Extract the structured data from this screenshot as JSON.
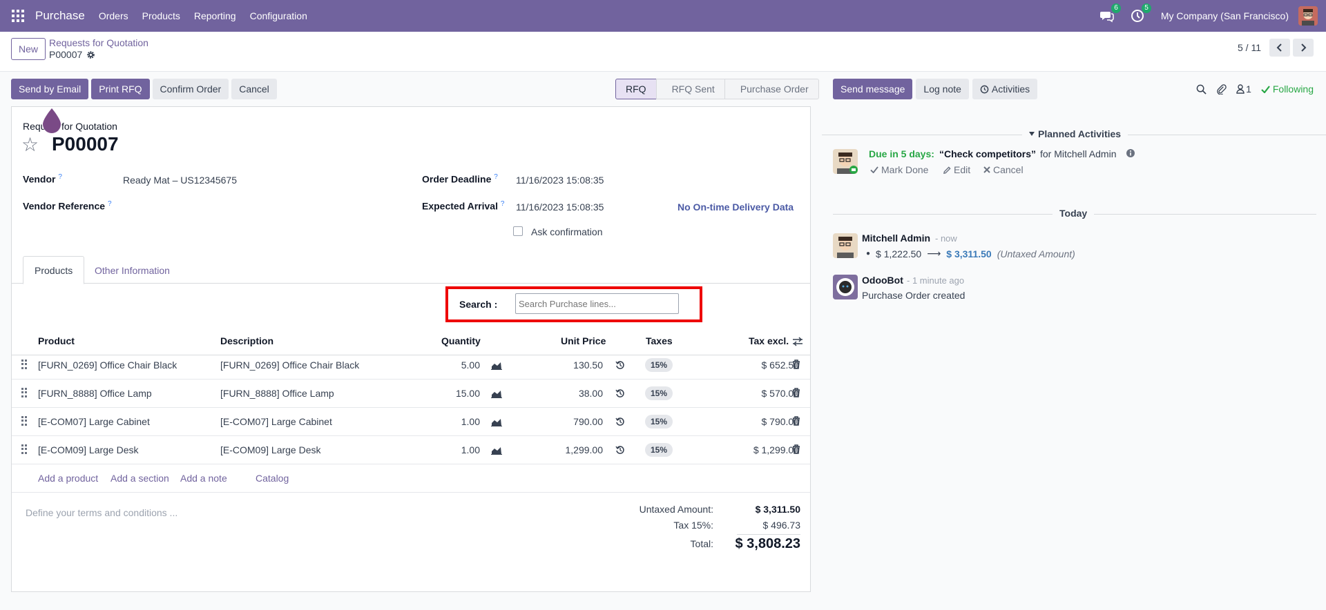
{
  "topbar": {
    "app": "Purchase",
    "menu": [
      "Orders",
      "Products",
      "Reporting",
      "Configuration"
    ],
    "messages_badge": "6",
    "activities_badge": "5",
    "company": "My Company (San Francisco)"
  },
  "controlpanel": {
    "new_label": "New",
    "breadcrumb": "Requests for Quotation",
    "record": "P00007",
    "pager": "5 / 11"
  },
  "actions": {
    "send_email": "Send by Email",
    "print_rfq": "Print RFQ",
    "confirm": "Confirm Order",
    "cancel": "Cancel"
  },
  "status": [
    "RFQ",
    "RFQ Sent",
    "Purchase Order"
  ],
  "form": {
    "subtitle": "Request for Quotation",
    "title": "P00007",
    "vendor_label": "Vendor",
    "vendor_value": "Ready Mat – US12345675",
    "vendor_ref_label": "Vendor Reference",
    "order_deadline_label": "Order Deadline",
    "order_deadline_value": "11/16/2023 15:08:35",
    "expected_arrival_label": "Expected Arrival",
    "expected_arrival_value": "11/16/2023 15:08:35",
    "otd_label": "No On-time Delivery Data",
    "ask_confirmation": "Ask confirmation",
    "help_mark": "?"
  },
  "tabs": [
    "Products",
    "Other Information"
  ],
  "search": {
    "label": "Search :",
    "placeholder": "Search Purchase lines..."
  },
  "table": {
    "headers": [
      "Product",
      "Description",
      "Quantity",
      "Unit Price",
      "Taxes",
      "Tax excl."
    ],
    "rows": [
      {
        "product": "[FURN_0269] Office Chair Black",
        "description": "[FURN_0269] Office Chair Black",
        "quantity": "5.00",
        "price": "130.50",
        "tax": "15%",
        "subtotal": "$ 652.50"
      },
      {
        "product": "[FURN_8888] Office Lamp",
        "description": "[FURN_8888] Office Lamp",
        "quantity": "15.00",
        "price": "38.00",
        "tax": "15%",
        "subtotal": "$ 570.00"
      },
      {
        "product": "[E-COM07] Large Cabinet",
        "description": "[E-COM07] Large Cabinet",
        "quantity": "1.00",
        "price": "790.00",
        "tax": "15%",
        "subtotal": "$ 790.00"
      },
      {
        "product": "[E-COM09] Large Desk",
        "description": "[E-COM09] Large Desk",
        "quantity": "1.00",
        "price": "1,299.00",
        "tax": "15%",
        "subtotal": "$ 1,299.00"
      }
    ],
    "add_product": "Add a product",
    "add_section": "Add a section",
    "add_note": "Add a note",
    "catalog": "Catalog"
  },
  "terms_placeholder": "Define your terms and conditions ...",
  "totals": {
    "untaxed_label": "Untaxed Amount:",
    "untaxed_value": "$ 3,311.50",
    "tax_label": "Tax 15%:",
    "tax_value": "$ 496.73",
    "total_label": "Total:",
    "total_value": "$ 3,808.23"
  },
  "chatter": {
    "send_message": "Send message",
    "log_note": "Log note",
    "activities": "Activities",
    "followers_count": "1",
    "following": "Following",
    "planned_title": "Planned Activities",
    "activity": {
      "due": "Due in 5 days:",
      "summary": "“Check competitors”",
      "for": "for Mitchell Admin",
      "mark_done": "Mark Done",
      "edit": "Edit",
      "cancel": "Cancel"
    },
    "today": "Today",
    "messages": [
      {
        "author": "Mitchell Admin",
        "time": "- now",
        "old": "$ 1,222.50",
        "arrow": "⟶",
        "new": "$ 3,311.50",
        "field": "(Untaxed Amount)"
      },
      {
        "author": "OdooBot",
        "time": "- 1 minute ago",
        "body": "Purchase Order created"
      }
    ]
  },
  "colors": {
    "brand": "#71639e",
    "highlight_box": "#e00000",
    "success": "#28a745"
  }
}
